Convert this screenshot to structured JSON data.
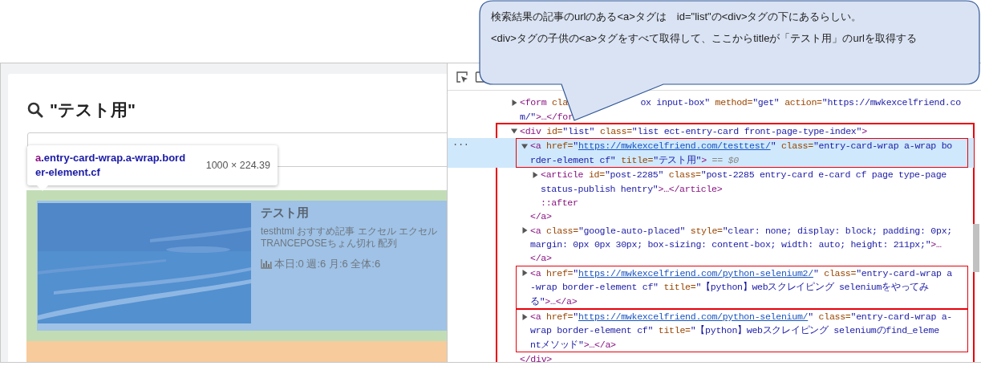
{
  "callout": {
    "lines": [
      "検索結果の記事のurlのある<a>タグは　id=\"list\"の<div>タグの下にあるらしい。",
      "<div>タグの子供の<a>タグをすべて取得して、ここからtitleが「テスト用」のurlを取得する"
    ]
  },
  "page": {
    "heading": "\"テスト用\"",
    "tooltip": {
      "tag": "a",
      "classes": ".entry-card-wrap.a-wrap.border-element.cf",
      "size": "1000 × 224.39"
    },
    "card": {
      "title": "テスト用",
      "tag_lines": [
        "testhtml おすすめ記事 エクセル エクセル",
        "TRANCEPOSEちょん切れ 配列"
      ],
      "stats": "本日:0 週:6 月:6 全体:6"
    }
  },
  "devtools": {
    "nodes": [
      {
        "kind": "element",
        "expanded": false,
        "selected": false,
        "lines": [
          [
            {
              "kind": "tag",
              "s": "<form"
            },
            {
              "kind": "attr",
              "s": " cla"
            },
            {
              "kind": "gap"
            },
            {
              "kind": "val",
              "s": "ox input-box\""
            },
            {
              "kind": "attr",
              "s": " method="
            },
            {
              "kind": "val",
              "s": "\"get\""
            },
            {
              "kind": "attr",
              "s": " action="
            },
            {
              "kind": "val",
              "s": "\"https://mwkexcelfriend.co"
            }
          ],
          [
            {
              "kind": "val",
              "s": "m/\""
            },
            {
              "kind": "tag",
              "s": ">…</for"
            }
          ]
        ]
      },
      {
        "kind": "element",
        "expanded": true,
        "selected": false,
        "outlined": true,
        "lines": [
          [
            {
              "kind": "tag",
              "s": "<div"
            },
            {
              "kind": "attr",
              "s": " id="
            },
            {
              "kind": "val",
              "s": "\"list\""
            },
            {
              "kind": "attr",
              "s": " class="
            },
            {
              "kind": "val",
              "s": "\"list ect-entry-card front-page-type-index\""
            },
            {
              "kind": "tag",
              "s": ">"
            }
          ]
        ],
        "children": [
          {
            "kind": "element",
            "expanded": true,
            "selected": true,
            "outlined": true,
            "gutter": "···",
            "lines": [
              [
                {
                  "kind": "tag",
                  "s": "<a"
                },
                {
                  "kind": "attr",
                  "s": " href="
                },
                {
                  "kind": "val",
                  "s": "\""
                },
                {
                  "kind": "link",
                  "s": "https://mwkexcelfriend.com/testtest/"
                },
                {
                  "kind": "val",
                  "s": "\""
                },
                {
                  "kind": "attr",
                  "s": " class="
                },
                {
                  "kind": "val",
                  "s": "\"entry-card-wrap a-wrap bo"
                }
              ],
              [
                {
                  "kind": "val",
                  "s": "rder-element cf\""
                },
                {
                  "kind": "attr",
                  "s": " title="
                },
                {
                  "kind": "val",
                  "s": "\"テスト用\""
                },
                {
                  "kind": "tag",
                  "s": ">"
                },
                {
                  "kind": "note",
                  "s": " == $0"
                }
              ]
            ],
            "children": [
              {
                "kind": "element",
                "expanded": false,
                "selected": false,
                "lines": [
                  [
                    {
                      "kind": "tag",
                      "s": "<article"
                    },
                    {
                      "kind": "attr",
                      "s": " id="
                    },
                    {
                      "kind": "val",
                      "s": "\"post-2285\""
                    },
                    {
                      "kind": "attr",
                      "s": " class="
                    },
                    {
                      "kind": "val",
                      "s": "\"post-2285 entry-card e-card cf page type-page"
                    }
                  ],
                  [
                    {
                      "kind": "val",
                      "s": "status-publish hentry\""
                    },
                    {
                      "kind": "tag",
                      "s": ">…</article>"
                    }
                  ]
                ]
              },
              {
                "kind": "pseudo",
                "selected": false,
                "lines": [
                  [
                    {
                      "kind": "pseudo",
                      "s": "::after"
                    }
                  ]
                ]
              }
            ],
            "close": [
              [
                {
                  "kind": "tag",
                  "s": "</a>"
                }
              ]
            ]
          },
          {
            "kind": "element",
            "expanded": false,
            "selected": false,
            "lines": [
              [
                {
                  "kind": "tag",
                  "s": "<a"
                },
                {
                  "kind": "attr",
                  "s": " class="
                },
                {
                  "kind": "val",
                  "s": "\"google-auto-placed\""
                },
                {
                  "kind": "attr",
                  "s": " style="
                },
                {
                  "kind": "val",
                  "s": "\"clear: none; display: block; padding: 0px;"
                }
              ],
              [
                {
                  "kind": "val",
                  "s": "margin: 0px 0px 30px; box-sizing: content-box; width: auto; height: 211px;\""
                },
                {
                  "kind": "tag",
                  "s": ">…"
                }
              ],
              [
                {
                  "kind": "tag",
                  "s": "</a>"
                }
              ]
            ]
          },
          {
            "kind": "element",
            "expanded": false,
            "selected": false,
            "outlined": true,
            "lines": [
              [
                {
                  "kind": "tag",
                  "s": "<a"
                },
                {
                  "kind": "attr",
                  "s": " href="
                },
                {
                  "kind": "val",
                  "s": "\""
                },
                {
                  "kind": "link",
                  "s": "https://mwkexcelfriend.com/python-selenium2/"
                },
                {
                  "kind": "val",
                  "s": "\""
                },
                {
                  "kind": "attr",
                  "s": " class="
                },
                {
                  "kind": "val",
                  "s": "\"entry-card-wrap a"
                }
              ],
              [
                {
                  "kind": "val",
                  "s": "-wrap border-element cf\""
                },
                {
                  "kind": "attr",
                  "s": " title="
                },
                {
                  "kind": "val",
                  "s": "\"【python】webスクレイピング seleniumをやってみ"
                }
              ],
              [
                {
                  "kind": "val",
                  "s": "る\""
                },
                {
                  "kind": "tag",
                  "s": ">…</a>"
                }
              ]
            ]
          },
          {
            "kind": "element",
            "expanded": false,
            "selected": false,
            "outlined": true,
            "lines": [
              [
                {
                  "kind": "tag",
                  "s": "<a"
                },
                {
                  "kind": "attr",
                  "s": " href="
                },
                {
                  "kind": "val",
                  "s": "\""
                },
                {
                  "kind": "link",
                  "s": "https://mwkexcelfriend.com/python-selenium/"
                },
                {
                  "kind": "val",
                  "s": "\""
                },
                {
                  "kind": "attr",
                  "s": " class="
                },
                {
                  "kind": "val",
                  "s": "\"entry-card-wrap a-"
                }
              ],
              [
                {
                  "kind": "val",
                  "s": "wrap border-element cf\""
                },
                {
                  "kind": "attr",
                  "s": " title="
                },
                {
                  "kind": "val",
                  "s": "\"【python】webスクレイピング seleniumのfind_eleme"
                }
              ],
              [
                {
                  "kind": "val",
                  "s": "ntメソッド\""
                },
                {
                  "kind": "tag",
                  "s": ">…</a>"
                }
              ]
            ]
          }
        ],
        "close": [
          [
            {
              "kind": "tag",
              "s": "</div>"
            }
          ]
        ]
      }
    ]
  }
}
